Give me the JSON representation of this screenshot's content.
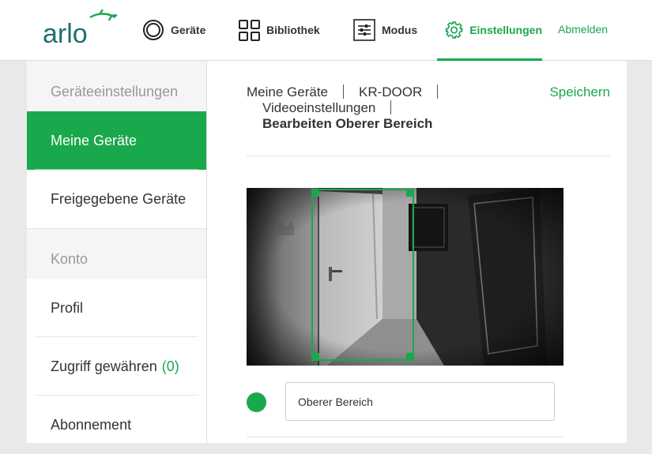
{
  "logo": {
    "text": "arlo"
  },
  "nav": {
    "devices": "Geräte",
    "library": "Bibliothek",
    "mode": "Modus",
    "settings": "Einstellungen",
    "logout": "Abmelden",
    "active": "settings",
    "accent": "#1aa84c"
  },
  "sidebar": {
    "section_device": "Geräteeinstellungen",
    "my_devices": "Meine Geräte",
    "shared_devices": "Freigegebene Geräte",
    "section_account": "Konto",
    "profile": "Profil",
    "grant_access": "Zugriff gewähren",
    "grant_access_count": "(0)",
    "subscription": "Abonnement"
  },
  "breadcrumb": {
    "level1": "Meine Geräte",
    "level2": "KR-DOOR",
    "level3": "Videoeinstellungen",
    "current": "Bearbeiten Oberer Bereich"
  },
  "actions": {
    "save": "Speichern"
  },
  "zone": {
    "name_value": "Oberer Bereich",
    "color": "#1aa84c"
  }
}
